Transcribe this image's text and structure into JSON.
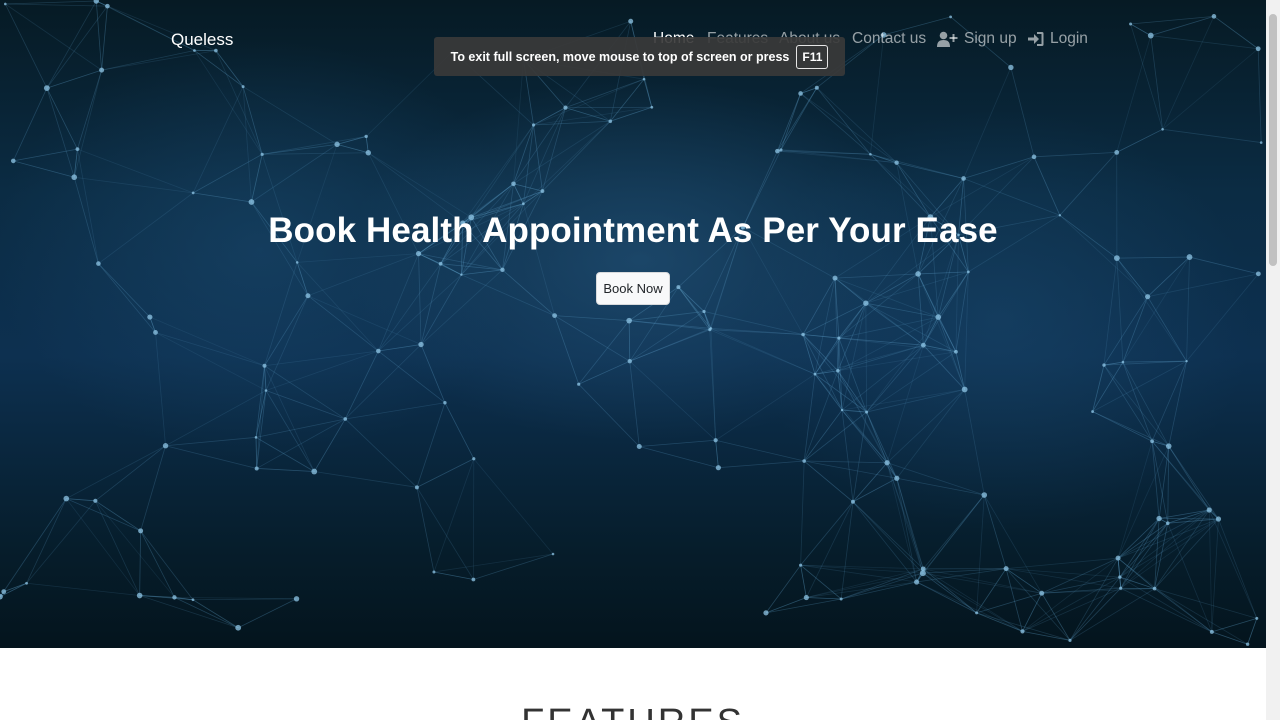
{
  "navbar": {
    "brand": "Queless",
    "links": [
      {
        "label": "Home",
        "active": true
      },
      {
        "label": "Features",
        "active": false
      },
      {
        "label": "About us",
        "active": false
      },
      {
        "label": "Contact us",
        "active": false
      }
    ],
    "signup": {
      "label": "Sign up",
      "icon": "user-plus-icon"
    },
    "login": {
      "label": "Login",
      "icon": "sign-in-icon"
    }
  },
  "fullscreen_notice": {
    "message": "To exit full screen, move mouse to top of screen or press",
    "key": "F11"
  },
  "hero": {
    "title": "Book Health Appointment As Per Your Ease",
    "button": "Book Now"
  },
  "features": {
    "title": "FEATURES"
  },
  "colors": {
    "hero_background": "#0b2c44",
    "network_lines": "#5b9cc4",
    "toast_background": "#3a3a3a",
    "button_background": "#f8f9fa"
  }
}
